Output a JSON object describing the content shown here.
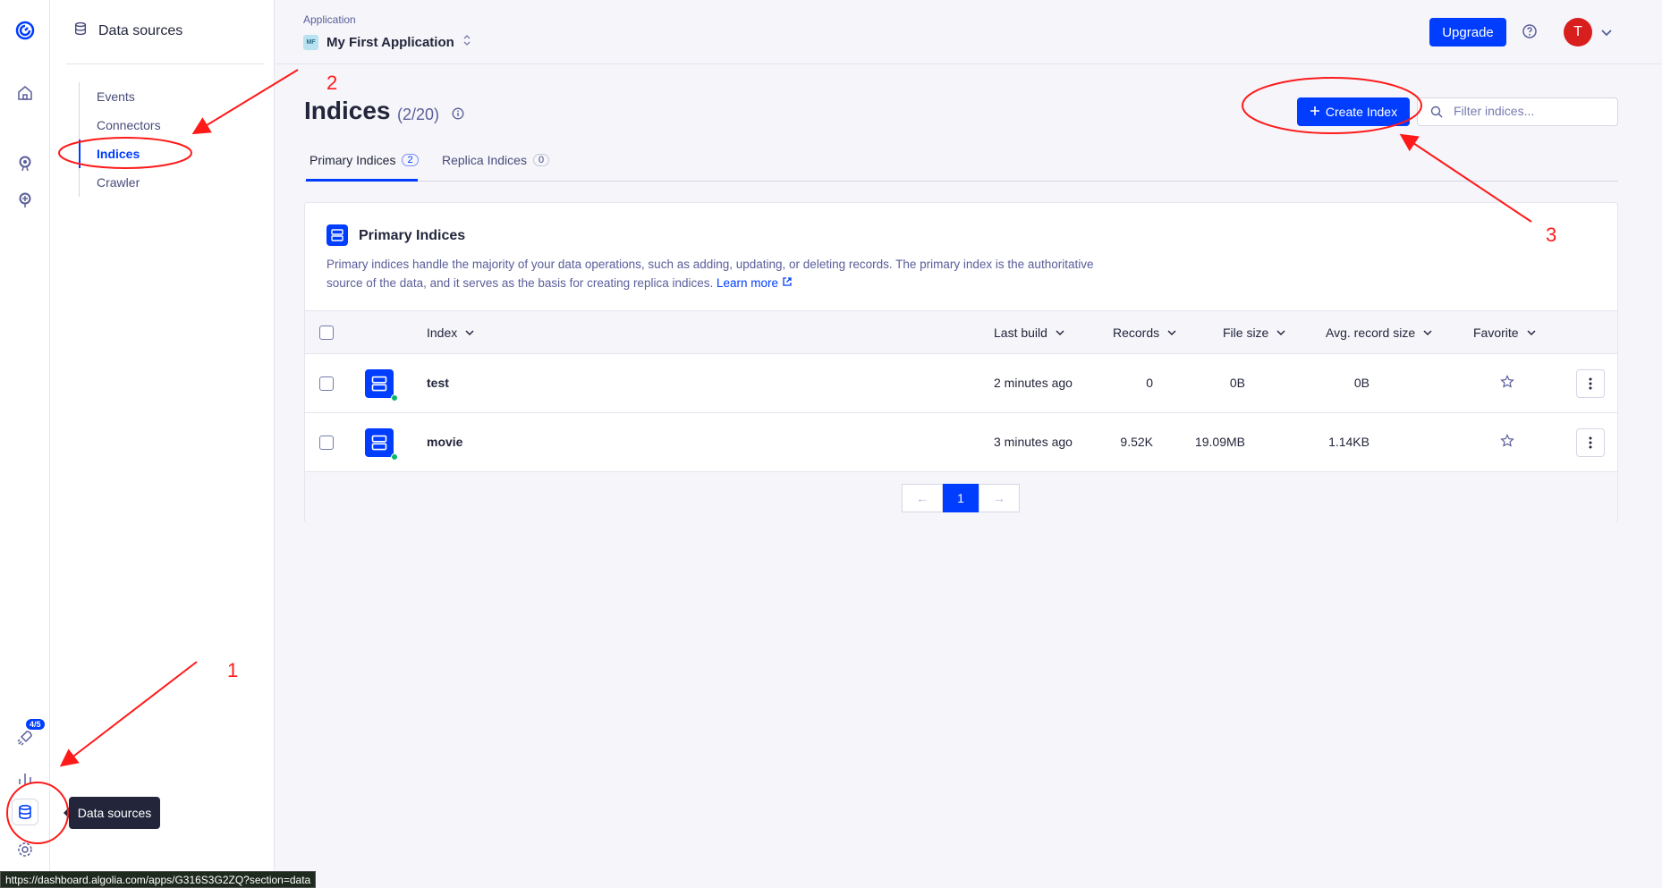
{
  "rail": {
    "onboarding_badge": "4/5",
    "icons": [
      "algolia-logo-icon",
      "home-icon",
      "search-icon",
      "discovery-icon",
      "rocket-icon",
      "analytics-icon",
      "data-sources-icon",
      "settings-icon"
    ]
  },
  "sidebar": {
    "title": "Data sources",
    "items": [
      {
        "label": "Events"
      },
      {
        "label": "Connectors"
      },
      {
        "label": "Indices"
      },
      {
        "label": "Crawler"
      }
    ]
  },
  "header": {
    "app_label": "Application",
    "app_initials": "MF",
    "app_name": "My First Application",
    "upgrade_label": "Upgrade",
    "avatar_initial": "T"
  },
  "page": {
    "title": "Indices",
    "count": "(2/20)",
    "create_label": "Create Index",
    "filter_placeholder": "Filter indices..."
  },
  "tabs": [
    {
      "label": "Primary Indices",
      "count": "2"
    },
    {
      "label": "Replica Indices",
      "count": "0"
    }
  ],
  "card": {
    "title": "Primary Indices",
    "description": "Primary indices handle the majority of your data operations, such as adding, updating, or deleting records. The primary index is the authoritative source of the data, and it serves as the basis for creating replica indices.",
    "learn_more": "Learn more"
  },
  "table": {
    "columns": [
      "Index",
      "Last build",
      "Records",
      "File size",
      "Avg. record size",
      "Favorite"
    ],
    "rows": [
      {
        "name": "test",
        "last_build": "2 minutes ago",
        "records": "0",
        "file_size": "0B",
        "avg_size": "0B"
      },
      {
        "name": "movie",
        "last_build": "3 minutes ago",
        "records": "9.52K",
        "file_size": "19.09MB",
        "avg_size": "1.14KB"
      }
    ]
  },
  "pagination": {
    "prev": "←",
    "current": "1",
    "next": "→"
  },
  "tooltip": "Data sources",
  "status_url": "https://dashboard.algolia.com/apps/G316S3G2ZQ?section=data",
  "annotations": [
    "1",
    "2",
    "3"
  ],
  "colors": {
    "accent": "#003dff",
    "annotation": "#ff1a1a",
    "avatar": "#d91e1e",
    "online_dot": "#06b66c"
  }
}
